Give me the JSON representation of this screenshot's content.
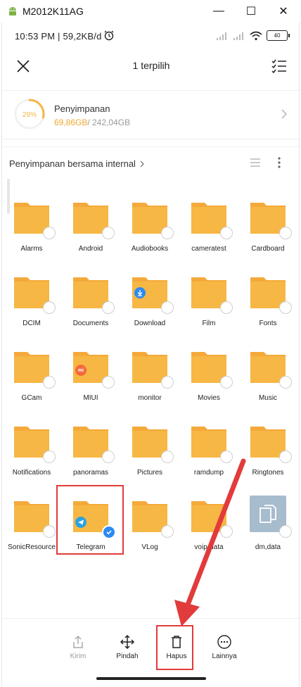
{
  "window": {
    "title": "M2012K11AG",
    "minimize": "—",
    "maximize": "☐",
    "close": "✕"
  },
  "statusbar": {
    "time": "10:53 PM | 59,2KB/d",
    "battery": "40"
  },
  "topbar": {
    "title": "1 terpilih"
  },
  "storage": {
    "percent_label": "29%",
    "percent": 0.29,
    "name": "Penyimpanan",
    "used": "69,86GB",
    "total": "/ 242,04GB"
  },
  "path": {
    "label": "Penyimpanan bersama internal"
  },
  "folders": [
    {
      "name": "Alarms"
    },
    {
      "name": "Android"
    },
    {
      "name": "Audiobooks"
    },
    {
      "name": "cameratest"
    },
    {
      "name": "Cardboard"
    },
    {
      "name": "DCIM"
    },
    {
      "name": "Documents"
    },
    {
      "name": "Download",
      "badge": "download-icon"
    },
    {
      "name": "Film"
    },
    {
      "name": "Fonts"
    },
    {
      "name": "GCam"
    },
    {
      "name": "MIUI",
      "badge": "miui-icon"
    },
    {
      "name": "monitor"
    },
    {
      "name": "Movies"
    },
    {
      "name": "Music"
    },
    {
      "name": "Notifications"
    },
    {
      "name": "panoramas"
    },
    {
      "name": "Pictures"
    },
    {
      "name": "ramdump"
    },
    {
      "name": "Ringtones"
    },
    {
      "name": "SonicResource"
    },
    {
      "name": "Telegram",
      "badge": "telegram-icon",
      "selected": true
    },
    {
      "name": "VLog"
    },
    {
      "name": "voip-data"
    },
    {
      "name": "dm,data",
      "type": "file"
    }
  ],
  "actions": {
    "send": "Kirim",
    "move": "Pindah",
    "delete": "Hapus",
    "more": "Lainnya"
  },
  "colors": {
    "folder": "#f7b744",
    "folder_tab": "#f4a93a",
    "accent": "#2a8bf2",
    "storage_ring": "#f3b646",
    "annotation_red": "#e23b3b"
  }
}
